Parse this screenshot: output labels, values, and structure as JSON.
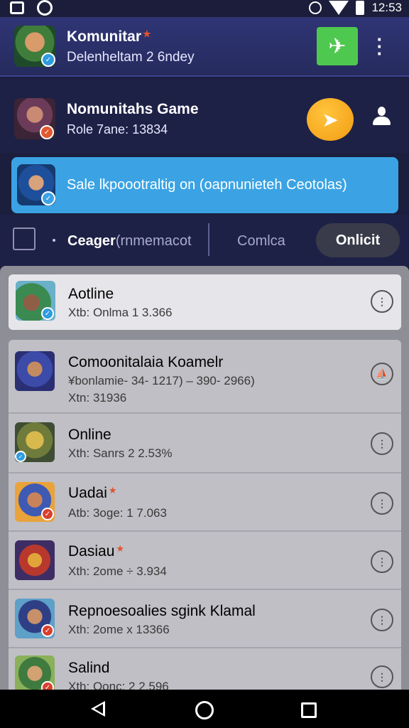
{
  "status_bar": {
    "time": "12:53"
  },
  "header": {
    "title": "Komunitar",
    "subtitle": "Delenheltam 2 6ndey"
  },
  "game": {
    "title": "Nomunitahs Game",
    "subtitle": "Role 7ane: 13834"
  },
  "banner": {
    "text": "Sale lkpoootraltig on (oapnunieteh Ceotolas)"
  },
  "tabs": {
    "active": "Ceager",
    "active_suffix": "(rnmemacot",
    "second": "Comlca",
    "pill": "Onlicit"
  },
  "online_entry": {
    "title": "Aotline",
    "subtitle": "Xtb: Onlma 1 3.366"
  },
  "items": [
    {
      "title": "Comoonitalaia Koamelr",
      "subtitle": "¥bonlamie- 34- 1217) – 390- 2966)",
      "extra": "Xtn: 31936"
    },
    {
      "title": "Online",
      "subtitle": "Xth: Sanrs 2 2.53%"
    },
    {
      "title": "Uadai",
      "subtitle": "Atb: 3oge: 1 7.063"
    },
    {
      "title": "Dasiau",
      "subtitle": "Xth: 2ome ÷ 3.934"
    },
    {
      "title": "Repnoesoalies sgink Klamal",
      "subtitle": "Xth: 2ome x 13366"
    },
    {
      "title": "Salind",
      "subtitle": "Xth: Oonc: 2 2.596"
    }
  ]
}
